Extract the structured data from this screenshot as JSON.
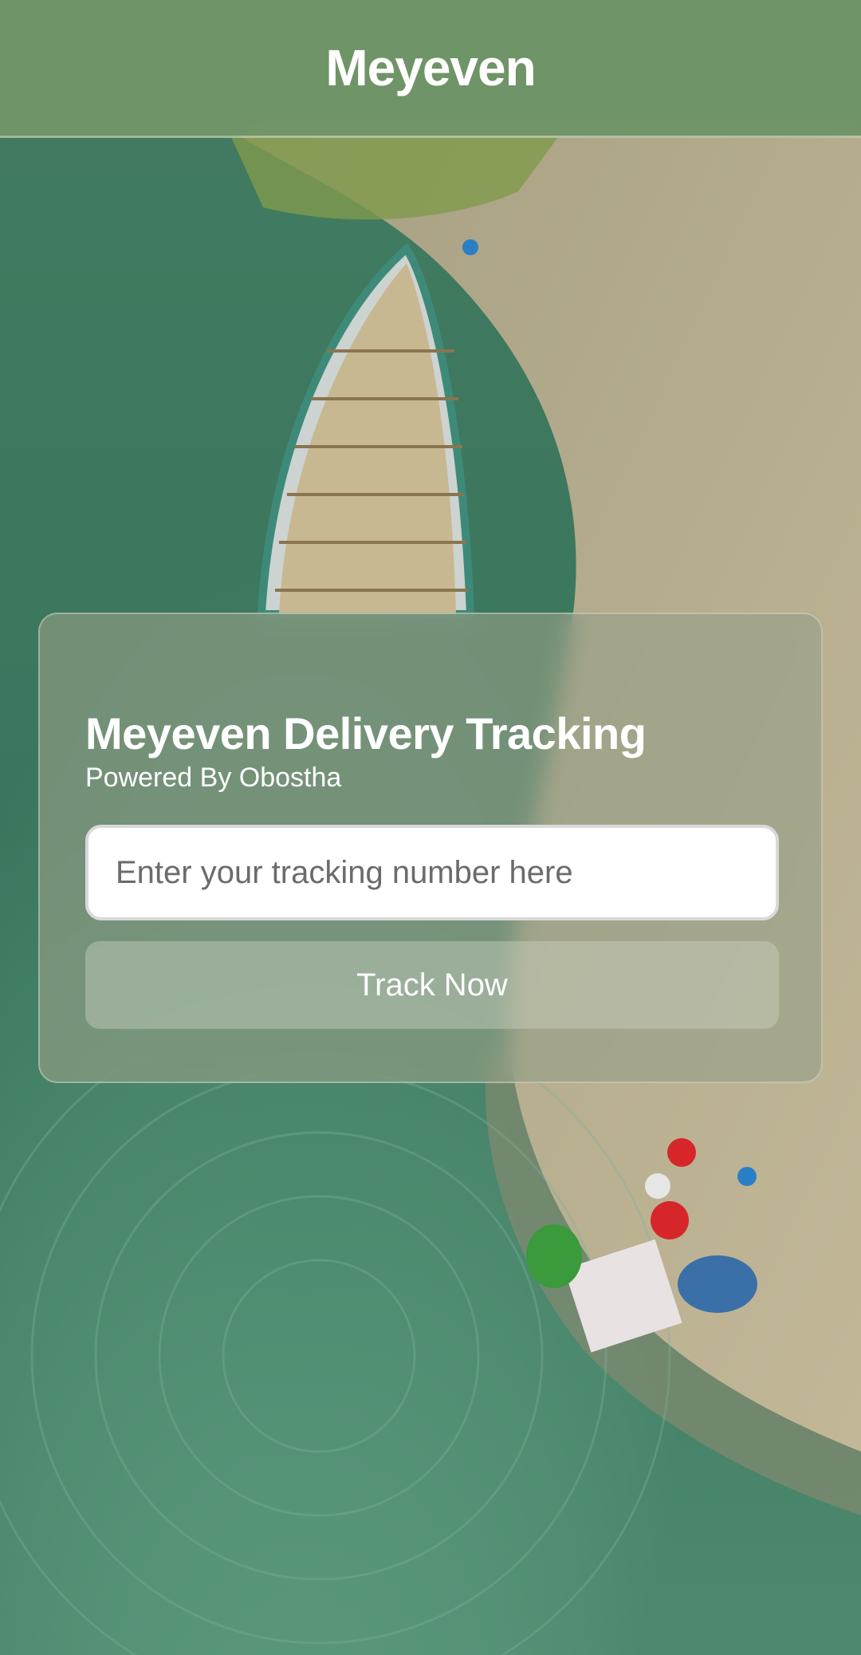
{
  "header": {
    "title": "Meyeven"
  },
  "card": {
    "title": "Meyeven Delivery Tracking",
    "subtitle": "Powered By Obostha",
    "tracking_input": {
      "value": "",
      "placeholder": "Enter your tracking number here"
    },
    "track_button_label": "Track Now"
  },
  "background": {
    "image_semantic": "aerial-river-boat-photo",
    "water_color": "#4f8a6e",
    "sand_color": "#b3a98a"
  }
}
